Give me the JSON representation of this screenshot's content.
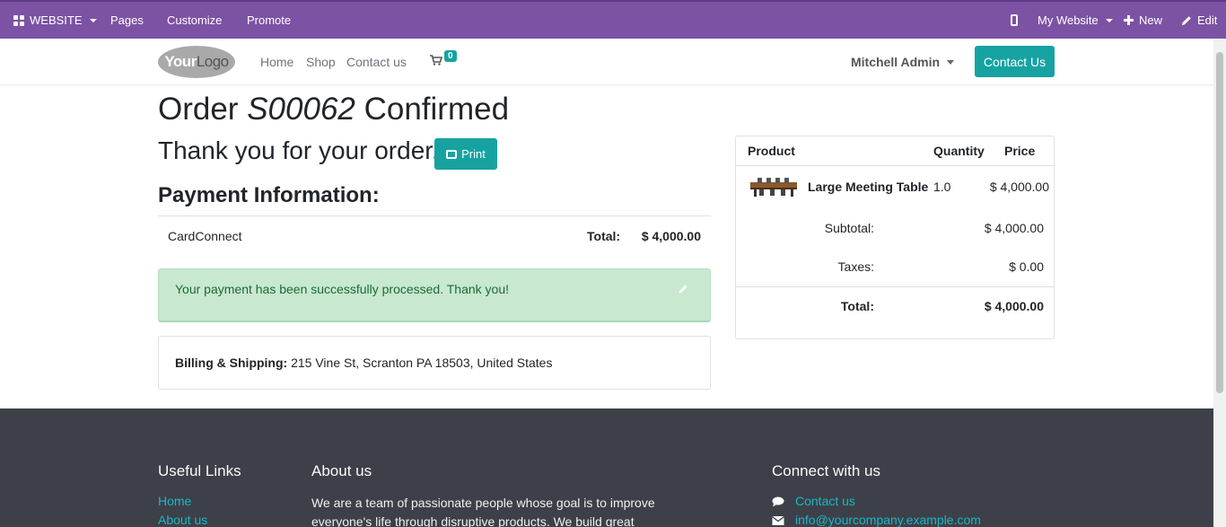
{
  "admin_bar": {
    "website_menu": "WEBSITE",
    "pages": "Pages",
    "customize": "Customize",
    "promote": "Promote",
    "my_website": "My Website",
    "new": "New",
    "edit": "Edit"
  },
  "header": {
    "logo_your": "Your",
    "logo_logo": "Logo",
    "nav": [
      "Home",
      "Shop",
      "Contact us"
    ],
    "cart_count": "0",
    "user": "Mitchell Admin",
    "contact_button": "Contact Us"
  },
  "order": {
    "title_prefix": "Order ",
    "order_ref": "S00062",
    "title_suffix": " Confirmed",
    "thanks": "Thank you for your order.",
    "print_label": "Print",
    "payment_heading": "Payment Information:",
    "payment_method": "CardConnect",
    "total_label": "Total:",
    "total_value": "$ 4,000.00",
    "success_message": "Your payment has been successfully processed. Thank you!",
    "billing_label": "Billing & Shipping:",
    "billing_address": " 215 Vine St, Scranton PA 18503, United States"
  },
  "summary": {
    "col_product": "Product",
    "col_quantity": "Quantity",
    "col_price": "Price",
    "product_name": "Large Meeting Table",
    "product_qty": "1.0",
    "product_price": "$ 4,000.00",
    "subtotal_label": "Subtotal:",
    "subtotal_value": "$ 4,000.00",
    "taxes_label": "Taxes:",
    "taxes_value": "$ 0.00",
    "total_label": "Total:",
    "total_value": "$ 4,000.00"
  },
  "footer": {
    "useful_links_heading": "Useful Links",
    "links": [
      "Home",
      "About us"
    ],
    "about_heading": "About us",
    "about_line1": "We are a team of passionate people whose goal is to improve",
    "about_line2": "everyone's life through disruptive products. We build great",
    "connect_heading": "Connect with us",
    "contact_link": "Contact us",
    "email_link": "info@yourcompany.example.com"
  },
  "colors": {
    "admin_bar": "#7c52a5",
    "accent": "#17a2a2",
    "success_bg": "#c8e8d0",
    "footer_bg": "#3d4049",
    "footer_link": "#17b8c6"
  }
}
